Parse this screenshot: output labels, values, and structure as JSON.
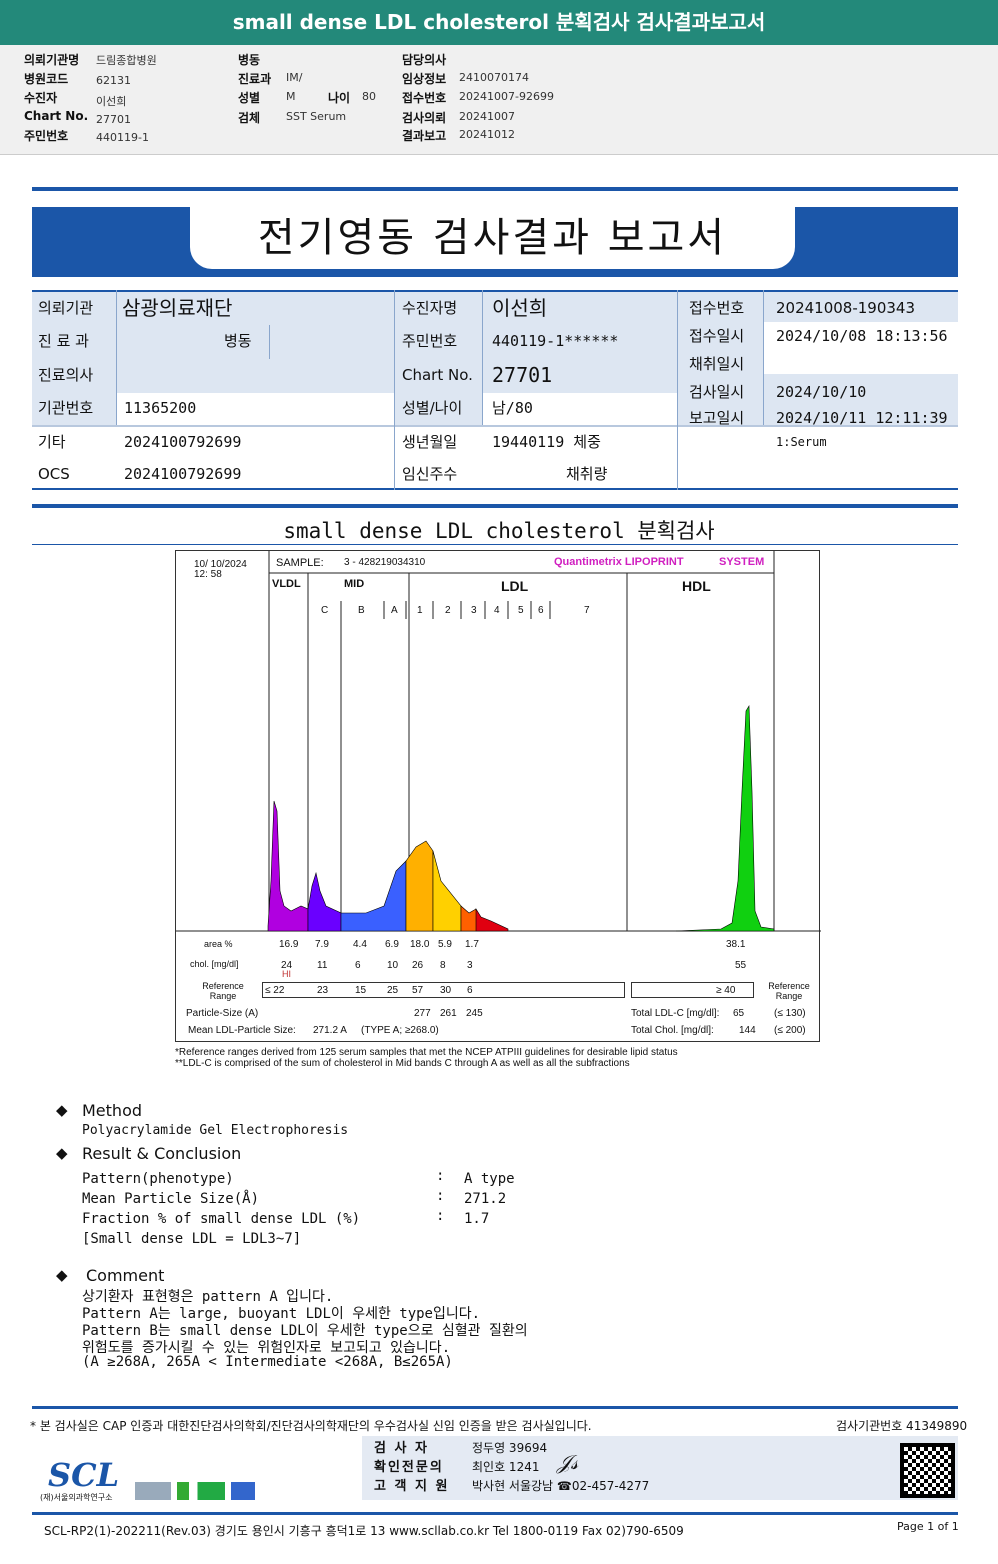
{
  "top_title": "small dense LDL cholesterol 분획검사 검사결과보고서",
  "info": {
    "c1": [
      [
        "의뢰기관명",
        "드림종합병원"
      ],
      [
        "병원코드",
        "62131"
      ],
      [
        "수진자",
        "이선희"
      ],
      [
        "Chart No.",
        "27701"
      ],
      [
        "주민번호",
        "440119-1"
      ]
    ],
    "c2": [
      [
        "병동",
        ""
      ],
      [
        "진료과",
        "IM/"
      ],
      [
        "성별",
        "M"
      ],
      [
        "검체",
        "SST Serum"
      ]
    ],
    "age_label": "나이",
    "age": "80",
    "c3": [
      [
        "담당의사",
        ""
      ],
      [
        "임상정보",
        "2410070174"
      ],
      [
        "접수번호",
        "20241007-92699"
      ],
      [
        "검사의뢰",
        "20241007"
      ],
      [
        "결과보고",
        "20241012"
      ]
    ]
  },
  "banner_title": "전기영동 검사결과 보고서",
  "table": {
    "r1": {
      "l1": "의뢰기관",
      "v1": "삼광의료재단",
      "l2": "수진자명",
      "v2": "이선희",
      "l3": "접수번호",
      "v3": "20241008-190343"
    },
    "r2": {
      "l1": "진 료 과",
      "v1": "병동",
      "l2": "주민번호",
      "v2": "440119-1******",
      "l3": "접수일시",
      "v3": "2024/10/08 18:13:56"
    },
    "r3": {
      "l1": "진료의사",
      "v1": "",
      "l2": "Chart No.",
      "v2": "27701",
      "l3": "채취일시",
      "v3": ""
    },
    "r4": {
      "l1": "기관번호",
      "v1": "11365200",
      "l2": "성별/나이",
      "v2": "남/80",
      "l3": "검사일시",
      "v3": "2024/10/10"
    },
    "r4b": {
      "l3": "보고일시",
      "v3": "2024/10/11 12:11:39"
    },
    "r5": {
      "l1": "기타",
      "v1": "2024100792699",
      "l2": "생년월일",
      "v2": "19440119 체중",
      "v3": "1:Serum"
    },
    "r6": {
      "l1": "OCS",
      "v1": "2024100792699",
      "l2": "임신주수",
      "v2": "채취량"
    }
  },
  "section_title": "small dense LDL cholesterol 분획검사",
  "lipoprint": {
    "date": "10/ 10/2024",
    "time": "12: 58",
    "sample_label": "SAMPLE:",
    "sample": "3 - 428219034310",
    "brand": "Quantimetrix LIPOPRINT",
    "brand2": "SYSTEM",
    "bands": [
      "VLDL",
      "MID",
      "LDL",
      "HDL"
    ],
    "subbands": [
      "C",
      "B",
      "A",
      "1",
      "2",
      "3",
      "4",
      "5",
      "6",
      "7"
    ],
    "area_label": "area %",
    "area": [
      "16.9",
      "7.9",
      "4.4",
      "6.9",
      "18.0",
      "5.9",
      "1.7"
    ],
    "area_hdl": "38.1",
    "chol_label": "chol. [mg/dl]",
    "chol": [
      "24",
      "11",
      "6",
      "10",
      "26",
      "8",
      "3"
    ],
    "chol_hdl": "55",
    "flag": "HI",
    "ref_label": "Reference Range",
    "ref": [
      "≤ 22",
      "23",
      "15",
      "25",
      "57",
      "30",
      "6"
    ],
    "ref_hdl": "≥ 40",
    "ps_label": "Particle-Size (A)",
    "ps": [
      "277",
      "261",
      "245"
    ],
    "mean_label": "Mean LDL-Particle Size:",
    "mean": "271.2 A",
    "mean_type": "(TYPE A; ≥268.0)",
    "ldl_label": "Total LDL-C [mg/dl]:",
    "ldl": "65",
    "ldl_ref": "(≤ 130)",
    "tc_label": "Total Chol. [mg/dl]:",
    "tc": "144",
    "tc_ref": "(≤ 200)",
    "colors": {
      "vldl": "#b000e0",
      "mid": "#6a00ff",
      "ldl1": "#ffd000",
      "hdl": "#10d010"
    }
  },
  "notes": [
    "*Reference ranges derived from 125 serum samples that met the NCEP ATPIII guidelines for desirable lipid status",
    "**LDL-C is comprised of the sum of cholesterol in Mid bands C through A as well as all the subfractions"
  ],
  "method": {
    "title": "Method",
    "text": "Polyacrylamide Gel Electrophoresis"
  },
  "result": {
    "title": "Result & Conclusion",
    "rows": [
      [
        "Pattern(phenotype)",
        ":",
        "A type"
      ],
      [
        "Mean Particle Size(Å)",
        ":",
        "271.2"
      ],
      [
        "Fraction % of small dense LDL (%)",
        ":",
        "1.7"
      ]
    ],
    "note": "[Small dense LDL = LDL3~7]"
  },
  "comment": {
    "title": "Comment",
    "lines": [
      "상기환자 표현형은 pattern A 입니다.",
      "Pattern A는 large, buoyant LDL이 우세한 type입니다.",
      "Pattern B는 small dense LDL이 우세한 type으로 심혈관 질환의",
      "위험도를 증가시킬 수 있는 위험인자로 보고되고 있습니다.",
      "(A ≥268A, 265A < Intermediate <268A, B≤265A)"
    ]
  },
  "footer": {
    "cert": "* 본 검사실은 CAP 인증과 대한진단검사의학회/진단검사의학재단의 우수검사실 신임 인증을 받은 검사실입니다.",
    "inst": "검사기관번호 41349890",
    "sign": [
      [
        "검 사 자",
        "정두영 39694"
      ],
      [
        "확인전문의",
        "최인호 1241"
      ],
      [
        "고 객 지 원",
        "박사현 서울강남 ☎02-457-4277"
      ]
    ],
    "logo": "SCL",
    "logo_sub": "(재)서울의과학연구소",
    "bottom": "SCL-RP2(1)-202211(Rev.03) 경기도 용인시 기흥구 흥덕1로 13 www.scllab.co.kr Tel 1800-0119 Fax 02)790-6509",
    "page": "Page 1 of 1"
  }
}
